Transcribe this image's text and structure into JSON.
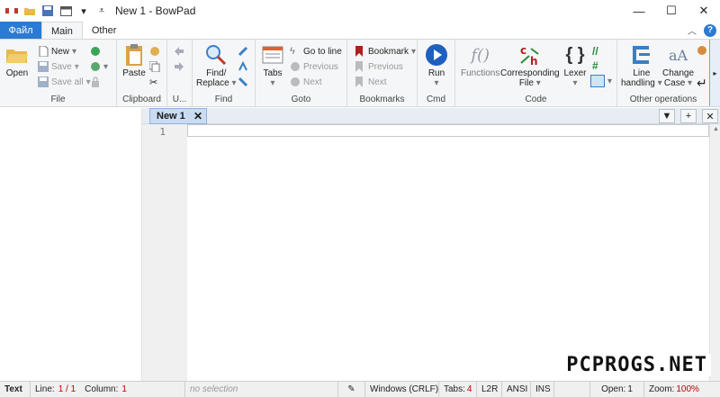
{
  "window": {
    "title": "New 1 - BowPad",
    "minimize": "—",
    "maximize": "☐",
    "close": "✕"
  },
  "ribbon_tabs": {
    "file": "Файл",
    "main": "Main",
    "other": "Other"
  },
  "groups": {
    "file": {
      "label": "File",
      "open": "Open",
      "new": "New",
      "save": "Save",
      "save_all": "Save all"
    },
    "clipboard": {
      "label": "Clipboard",
      "paste": "Paste"
    },
    "undo": {
      "label": "U..."
    },
    "find": {
      "label": "Find",
      "find_replace_1": "Find/",
      "find_replace_2": "Replace"
    },
    "goto": {
      "label": "Goto",
      "tabs": "Tabs",
      "go_to_line": "Go to line",
      "previous": "Previous",
      "next": "Next"
    },
    "bookmarks": {
      "label": "Bookmarks",
      "bookmark": "Bookmark",
      "previous": "Previous",
      "next": "Next"
    },
    "cmd": {
      "label": "Cmd",
      "run": "Run"
    },
    "code": {
      "label": "Code",
      "functions": "Functions",
      "corresponding_1": "Corresponding",
      "corresponding_2": "File",
      "lexer": "Lexer"
    },
    "other_ops": {
      "label": "Other operations",
      "line_handling_1": "Line",
      "line_handling_2": "handling",
      "change_case_1": "Change",
      "change_case_2": "Case"
    }
  },
  "document": {
    "tab_name": "New 1",
    "line_number": "1"
  },
  "status_bar": {
    "mode": "Text",
    "line_label": "Line:",
    "line_value": "1 / 1",
    "column_label": "Column:",
    "column_value": "1",
    "selection": "no selection",
    "eol": "Windows (CRLF)",
    "tabs_label": "Tabs:",
    "tabs_value": "4",
    "direction": "L2R",
    "encoding": "ANSI",
    "ins": "INS",
    "open_label": "Open:",
    "open_value": "1",
    "zoom_label": "Zoom:",
    "zoom_value": "100%"
  },
  "watermark": "PCPROGS.NET",
  "colors": {
    "file_tab": "#2b7bd2",
    "ribbon_bg": "#f5f6f7",
    "doc_tab": "#c9dcf2"
  }
}
